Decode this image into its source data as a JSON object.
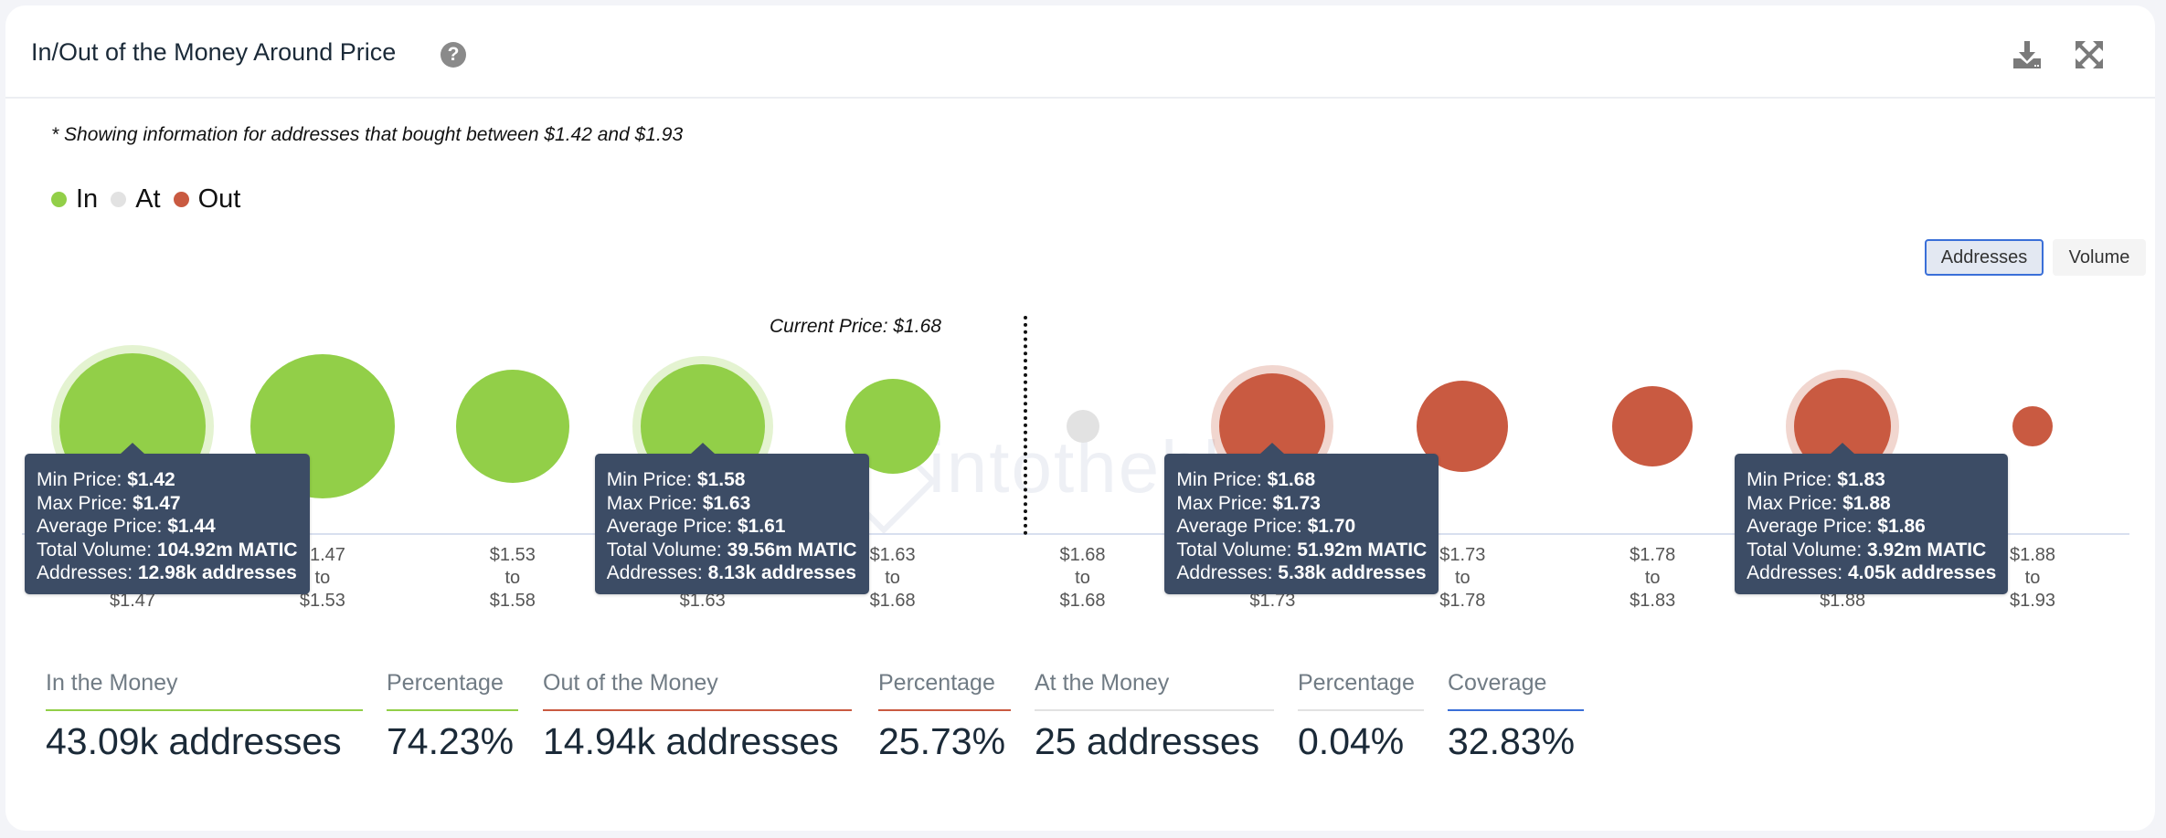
{
  "header": {
    "title": "In/Out of the Money Around Price",
    "help_icon": "question-circle-icon",
    "download_icon": "download-icon",
    "expand_icon": "expand-icon"
  },
  "subtitle": "* Showing information for addresses that bought between $1.42 and $1.93",
  "legend": [
    {
      "label": "In",
      "color": "#92cf48"
    },
    {
      "label": "At",
      "color": "#e2e2e2"
    },
    {
      "label": "Out",
      "color": "#c95a41"
    }
  ],
  "view_toggle": {
    "options": [
      "Addresses",
      "Volume"
    ],
    "selected": "Addresses"
  },
  "watermark": "intotheblock",
  "chart_data": {
    "type": "bubble",
    "title": "In/Out of the Money Around Price",
    "current_price_label": "Current Price: $1.68",
    "current_price": 1.68,
    "size_metric": "Addresses",
    "categories": [
      "$1.42 to $1.47",
      "$1.47 to $1.53",
      "$1.53 to $1.58",
      "$1.58 to $1.63",
      "$1.63 to $1.68",
      "$1.68 to $1.68",
      "$1.68 to $1.73",
      "$1.73 to $1.78",
      "$1.78 to $1.83",
      "$1.83 to $1.88",
      "$1.88 to $1.93"
    ],
    "buckets": [
      {
        "min": "$1.42",
        "max": "$1.47",
        "status": "In",
        "rel_size": 0.8
      },
      {
        "min": "$1.47",
        "max": "$1.53",
        "status": "In",
        "rel_size": 0.79
      },
      {
        "min": "$1.53",
        "max": "$1.58",
        "status": "In",
        "rel_size": 0.62
      },
      {
        "min": "$1.58",
        "max": "$1.63",
        "status": "In",
        "rel_size": 0.68
      },
      {
        "min": "$1.63",
        "max": "$1.68",
        "status": "In",
        "rel_size": 0.52
      },
      {
        "min": "$1.68",
        "max": "$1.68",
        "status": "At",
        "rel_size": 0.18
      },
      {
        "min": "$1.68",
        "max": "$1.73",
        "status": "Out",
        "rel_size": 0.58
      },
      {
        "min": "$1.73",
        "max": "$1.78",
        "status": "Out",
        "rel_size": 0.5
      },
      {
        "min": "$1.78",
        "max": "$1.83",
        "status": "Out",
        "rel_size": 0.44
      },
      {
        "min": "$1.83",
        "max": "$1.88",
        "status": "Out",
        "rel_size": 0.53
      },
      {
        "min": "$1.88",
        "max": "$1.93",
        "status": "Out",
        "rel_size": 0.22
      }
    ],
    "tooltips": [
      {
        "bucket_index": 0,
        "min_price": "$1.42",
        "max_price": "$1.47",
        "avg_price": "$1.44",
        "total_volume": "104.92m MATIC",
        "addresses": "12.98k addresses"
      },
      {
        "bucket_index": 3,
        "min_price": "$1.58",
        "max_price": "$1.63",
        "avg_price": "$1.61",
        "total_volume": "39.56m MATIC",
        "addresses": "8.13k addresses"
      },
      {
        "bucket_index": 6,
        "min_price": "$1.68",
        "max_price": "$1.73",
        "avg_price": "$1.70",
        "total_volume": "51.92m MATIC",
        "addresses": "5.38k addresses"
      },
      {
        "bucket_index": 9,
        "min_price": "$1.83",
        "max_price": "$1.88",
        "avg_price": "$1.86",
        "total_volume": "3.92m MATIC",
        "addresses": "4.05k addresses"
      }
    ],
    "tooltip_labels": {
      "min_price": "Min Price: ",
      "max_price": "Max Price: ",
      "avg_price": "Average Price: ",
      "total_volume": "Total Volume: ",
      "addresses": "Addresses: "
    },
    "colors": {
      "In": "#92cf48",
      "At": "#e2e2e2",
      "Out": "#c95a41"
    }
  },
  "stats": [
    {
      "label": "In the Money",
      "value": "43.09k addresses",
      "color": "#92cf48"
    },
    {
      "label": "Percentage",
      "value": "74.23%",
      "color": "#92cf48"
    },
    {
      "label": "Out of the Money",
      "value": "14.94k addresses",
      "color": "#c95a41"
    },
    {
      "label": "Percentage",
      "value": "25.73%",
      "color": "#c95a41"
    },
    {
      "label": "At the Money",
      "value": "25 addresses",
      "color": "#e2e2e2"
    },
    {
      "label": "Percentage",
      "value": "0.04%",
      "color": "#e2e2e2"
    },
    {
      "label": "Coverage",
      "value": "32.83%",
      "color": "#3a6fd8"
    }
  ]
}
